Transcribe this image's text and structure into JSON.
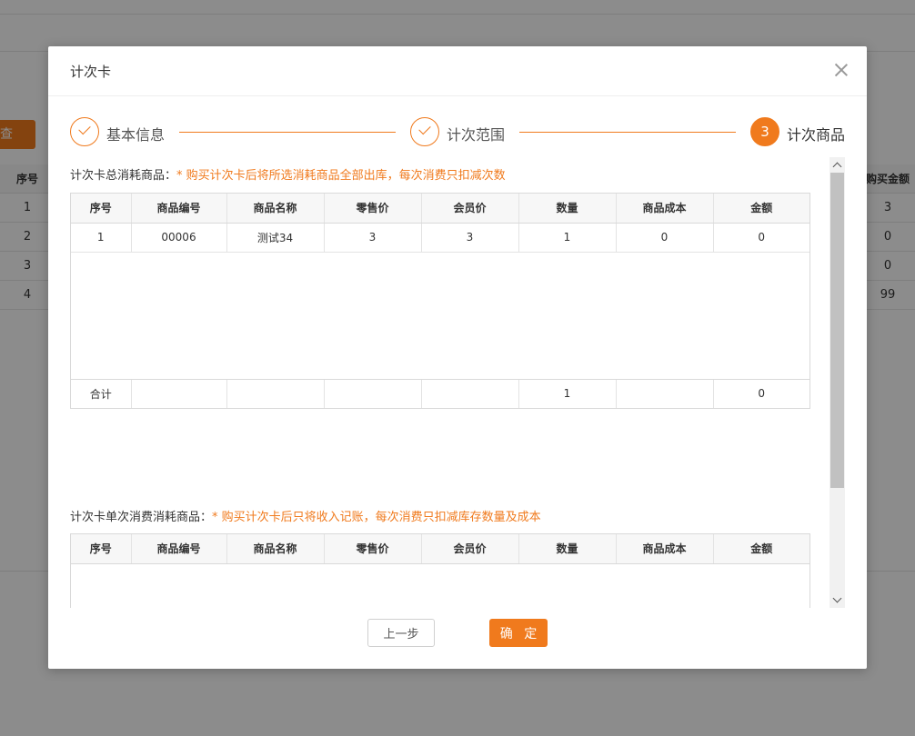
{
  "background": {
    "query_button": "查 询",
    "left_column": {
      "header": "序号",
      "rows": [
        "1",
        "2",
        "3",
        "4"
      ]
    },
    "right_column": {
      "header": "购买金额",
      "rows": [
        "3",
        "0",
        "0",
        "99"
      ]
    }
  },
  "modal": {
    "title": "计次卡",
    "steps": [
      {
        "label": "基本信息",
        "status": "done"
      },
      {
        "label": "计次范围",
        "status": "done"
      },
      {
        "label": "计次商品",
        "status": "active",
        "number": "3"
      }
    ],
    "section1": {
      "title": "计次卡总消耗商品：",
      "hint": "* 购买计次卡后将所选消耗商品全部出库，每次消费只扣减次数",
      "columns": [
        "序号",
        "商品编号",
        "商品名称",
        "零售价",
        "会员价",
        "数量",
        "商品成本",
        "金额"
      ],
      "rows": [
        [
          "1",
          "00006",
          "测试34",
          "3",
          "3",
          "1",
          "0",
          "0"
        ]
      ],
      "total": [
        "合计",
        "",
        "",
        "",
        "",
        "1",
        "",
        "0"
      ]
    },
    "section2": {
      "title": "计次卡单次消费消耗商品：",
      "hint": "* 购买计次卡后只将收入记账，每次消费只扣减库存数量及成本",
      "columns": [
        "序号",
        "商品编号",
        "商品名称",
        "零售价",
        "会员价",
        "数量",
        "商品成本",
        "金额"
      ],
      "empty_icon": "empty-inbox-icon"
    },
    "buttons": {
      "prev": "上一步",
      "ok": "确 定"
    }
  },
  "colors": {
    "accent": "#f07a1d"
  }
}
